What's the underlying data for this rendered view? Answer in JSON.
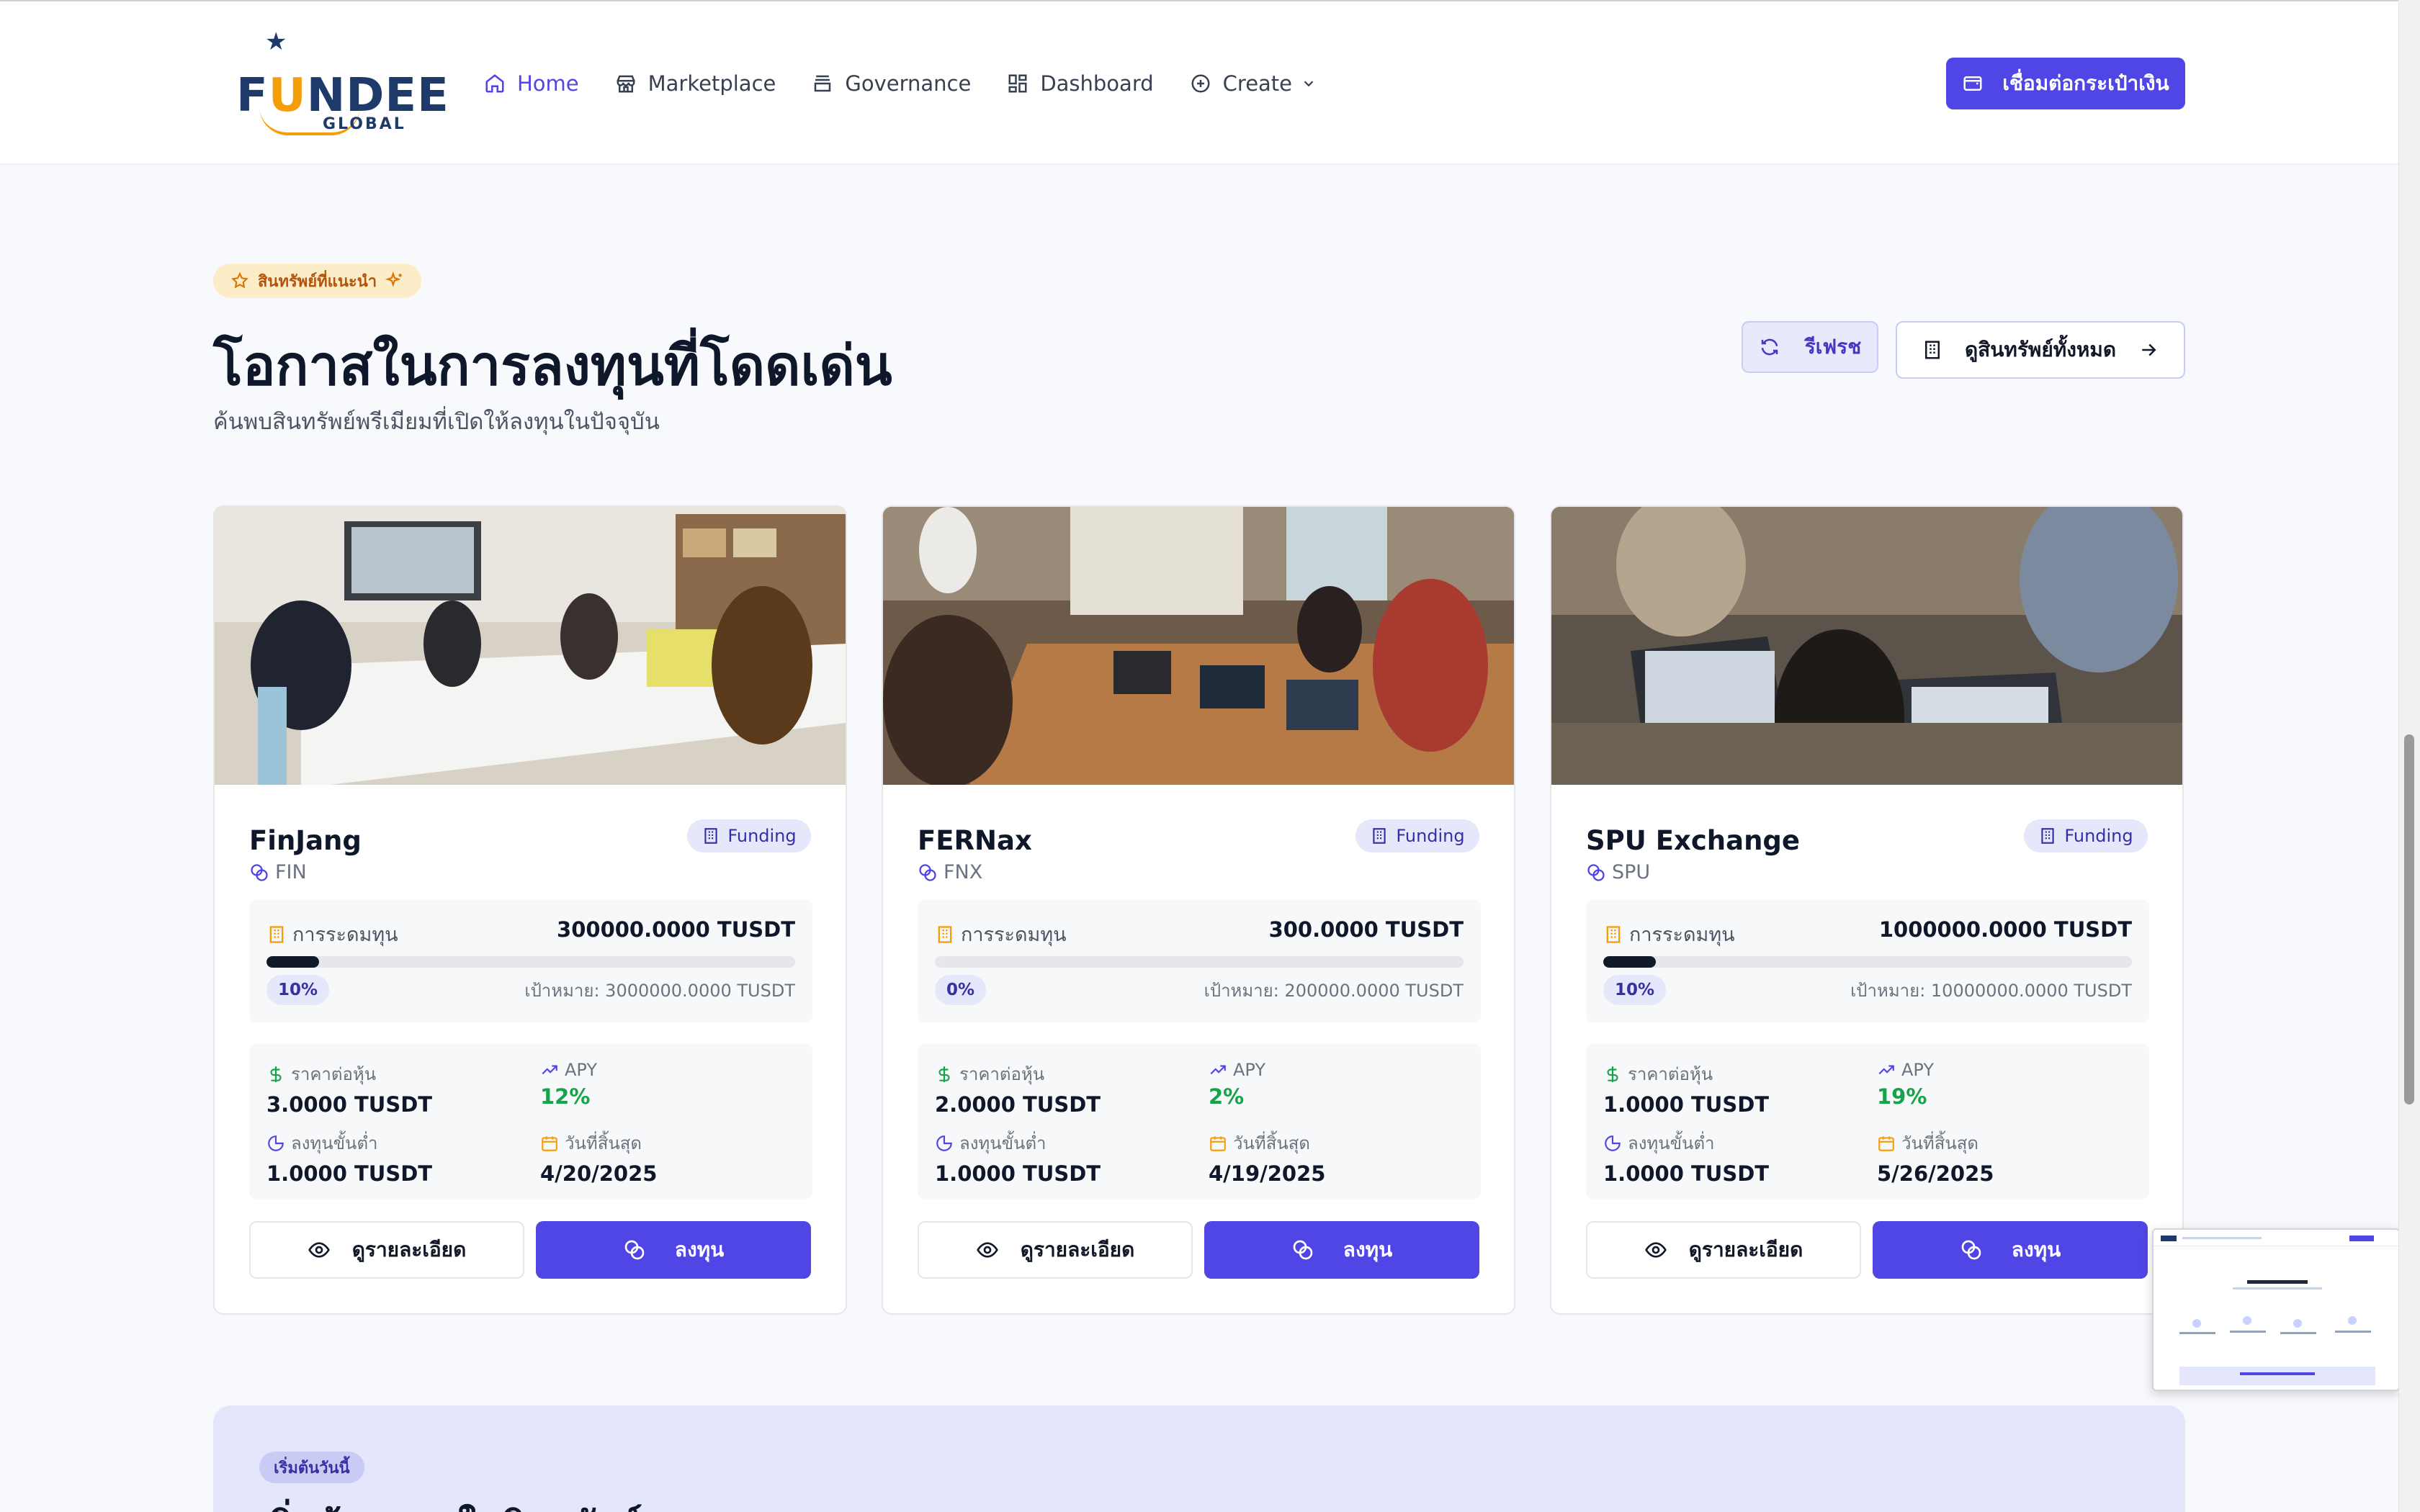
{
  "brand": {
    "logo_pre": "F",
    "logo_u": "U",
    "logo_post": "NDEE",
    "logo_sub": "GLOBAL"
  },
  "nav": {
    "home": "Home",
    "marketplace": "Marketplace",
    "governance": "Governance",
    "dashboard": "Dashboard",
    "create": "Create"
  },
  "wallet_button": "เชื่อมต่อกระเป๋าเงิน",
  "section": {
    "badge": "สินทรัพย์ที่แนะนำ",
    "title": "โอกาสในการลงทุนที่โดดเด่น",
    "subtitle": "ค้นพบสินทรัพย์พรีเมียมที่เปิดให้ลงทุนในปัจจุบัน",
    "refresh": "รีเฟรช",
    "view_all": "ดูสินทรัพย์ทั้งหมด"
  },
  "labels": {
    "raised": "การระดมทุน",
    "target_prefix": "เป้าหมาย:",
    "price_per_share": "ราคาต่อหุ้น",
    "apy": "APY",
    "min_invest": "ลงทุนขั้นต่ำ",
    "end_date": "วันที่สิ้นสุด",
    "view_details": "ดูรายละเอียด",
    "invest": "ลงทุน"
  },
  "cards": [
    {
      "name": "FinJang",
      "symbol": "FIN",
      "status": "Funding",
      "raised": "300000.0000 TUSDT",
      "progress_pct": 10,
      "progress_label": "10%",
      "target": "เป้าหมาย: 3000000.0000 TUSDT",
      "price": "3.0000 TUSDT",
      "apy": "12%",
      "min": "1.0000 TUSDT",
      "end": "4/20/2025"
    },
    {
      "name": "FERNax",
      "symbol": "FNX",
      "status": "Funding",
      "raised": "300.0000 TUSDT",
      "progress_pct": 0,
      "progress_label": "0%",
      "target": "เป้าหมาย: 200000.0000 TUSDT",
      "price": "2.0000 TUSDT",
      "apy": "2%",
      "min": "1.0000 TUSDT",
      "end": "4/19/2025"
    },
    {
      "name": "SPU Exchange",
      "symbol": "SPU",
      "status": "Funding",
      "raised": "1000000.0000 TUSDT",
      "progress_pct": 10,
      "progress_label": "10%",
      "target": "เป้าหมาย: 10000000.0000 TUSDT",
      "price": "1.0000 TUSDT",
      "apy": "19%",
      "min": "1.0000 TUSDT",
      "end": "5/26/2025"
    }
  ],
  "cta": {
    "badge": "เริ่มต้นวันนี้",
    "title": "เริ่มต้นลงทุนในสินทรัพย์"
  },
  "colors": {
    "primary": "#4f46e5",
    "badge_bg": "#fdecc8",
    "badge_text": "#b45309",
    "apy_green": "#16a34a",
    "page_bg": "#f8f9fc"
  }
}
